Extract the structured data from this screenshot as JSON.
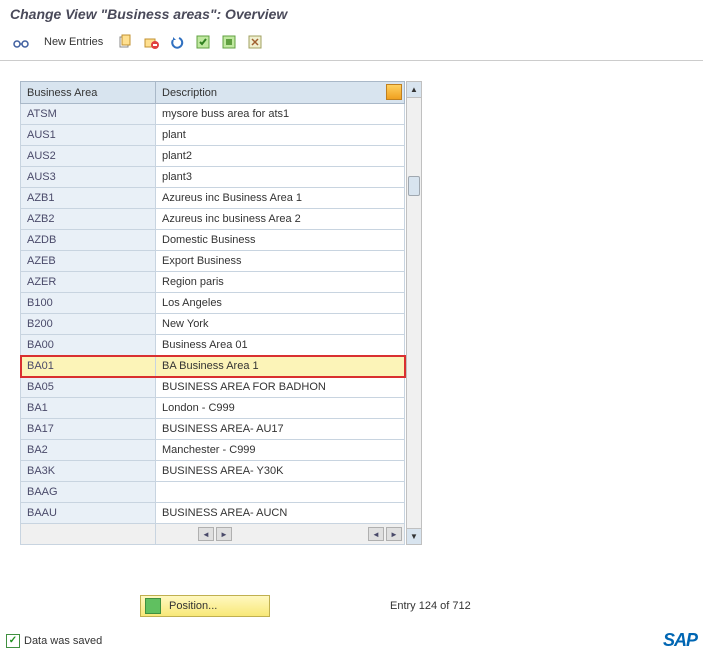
{
  "title": "Change View \"Business areas\": Overview",
  "toolbar": {
    "new_entries": "New Entries"
  },
  "table": {
    "headers": {
      "code": "Business Area",
      "desc": "Description"
    },
    "rows": [
      {
        "code": "ATSM",
        "desc": "mysore buss area for ats1"
      },
      {
        "code": "AUS1",
        "desc": "plant"
      },
      {
        "code": "AUS2",
        "desc": "plant2"
      },
      {
        "code": "AUS3",
        "desc": "plant3"
      },
      {
        "code": "AZB1",
        "desc": "Azureus inc Business Area 1"
      },
      {
        "code": "AZB2",
        "desc": "Azureus inc business Area 2"
      },
      {
        "code": "AZDB",
        "desc": "Domestic Business"
      },
      {
        "code": "AZEB",
        "desc": "Export Business"
      },
      {
        "code": "AZER",
        "desc": "Region paris"
      },
      {
        "code": "B100",
        "desc": "Los Angeles"
      },
      {
        "code": "B200",
        "desc": "New York"
      },
      {
        "code": "BA00",
        "desc": "Business Area 01"
      },
      {
        "code": "BA01",
        "desc": "BA Business Area 1",
        "highlight": true
      },
      {
        "code": "BA05",
        "desc": "BUSINESS AREA FOR BADHON"
      },
      {
        "code": "BA1",
        "desc": "London - C999"
      },
      {
        "code": "BA17",
        "desc": "BUSINESS AREA- AU17"
      },
      {
        "code": "BA2",
        "desc": "Manchester - C999"
      },
      {
        "code": "BA3K",
        "desc": "BUSINESS AREA- Y30K"
      },
      {
        "code": "BAAG",
        "desc": ""
      },
      {
        "code": "BAAU",
        "desc": "BUSINESS AREA- AUCN"
      }
    ]
  },
  "position_label": "Position...",
  "entry_text": "Entry 124 of 712",
  "status_text": "Data was saved",
  "brand": "SAP"
}
